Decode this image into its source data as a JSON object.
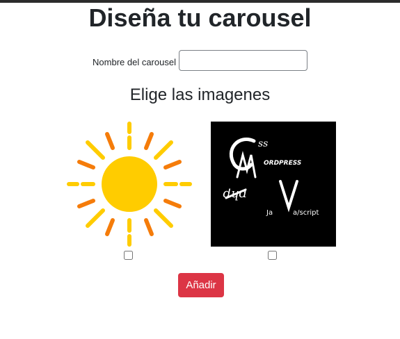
{
  "page": {
    "title": "Diseña tu carousel",
    "section_heading": "Elige las imagenes"
  },
  "form": {
    "name_label": "Nombre del carousel",
    "name_value": "",
    "add_button": "Añadir"
  },
  "images": [
    {
      "icon": "sun-icon",
      "checked": false,
      "colors": {
        "core": "#ffcc00",
        "rays_yellow": "#ffcc00",
        "rays_orange": "#f57c0a"
      }
    },
    {
      "icon": "web-languages-logo",
      "checked": false,
      "logo_text": [
        "CSS",
        "WORDPRESS",
        "JAVASCRIPT",
        "PHP"
      ],
      "colors": {
        "background": "#000000",
        "ink": "#ffffff"
      }
    }
  ],
  "colors": {
    "add_button": "#dc3545",
    "top_bar": "#2b2b2b"
  }
}
